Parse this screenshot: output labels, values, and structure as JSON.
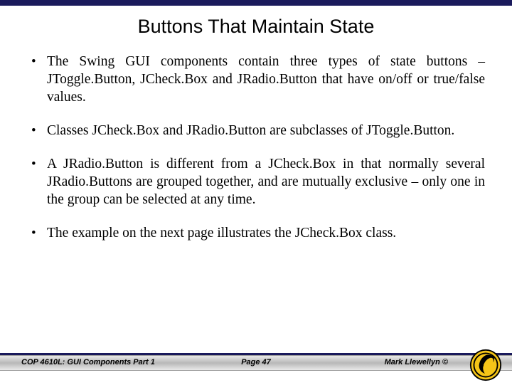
{
  "title": "Buttons That Maintain State",
  "bullets": [
    "The Swing GUI components contain three types of state buttons – JToggle.Button, JCheck.Box and JRadio.Button that have on/off or true/false values.",
    "Classes JCheck.Box and JRadio.Button are subclasses of JToggle.Button.",
    "A JRadio.Button is different from a JCheck.Box in that normally several JRadio.Buttons are grouped together, and are mutually exclusive – only one in the group can be selected at any time.",
    "The example on the next page illustrates the JCheck.Box class."
  ],
  "footer": {
    "left": "COP 4610L: GUI Components Part 1",
    "center": "Page 47",
    "right": "Mark Llewellyn ©"
  }
}
